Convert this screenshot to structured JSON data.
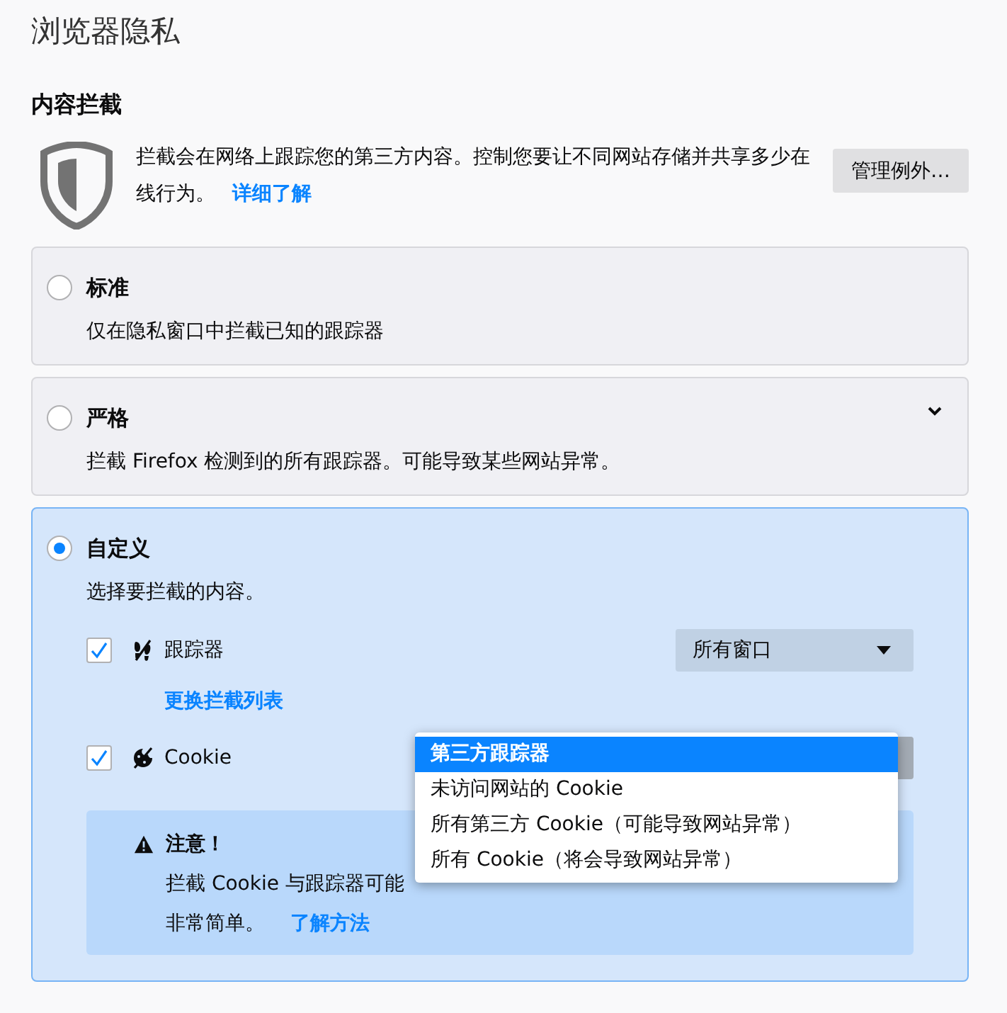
{
  "page": {
    "title": "浏览器隐私"
  },
  "content_blocking": {
    "heading": "内容拦截",
    "description": "拦截会在网络上跟踪您的第三方内容。控制您要让不同网站存储并共享多少在线行为。",
    "learn_more_link": "详细了解",
    "exceptions_button": "管理例外…"
  },
  "modes": [
    {
      "title": "标准",
      "description": "仅在隐私窗口中拦截已知的跟踪器",
      "selected": false,
      "expandable": false
    },
    {
      "title": "严格",
      "description": "拦截 Firefox 检测到的所有跟踪器。可能导致某些网站异常。",
      "selected": false,
      "expandable": true
    },
    {
      "title": "自定义",
      "description": "选择要拦截的内容。",
      "selected": true,
      "expandable": false,
      "options": [
        {
          "kind": "tracker",
          "label": "跟踪器",
          "checked": true,
          "dropdown": {
            "value": "所有窗口",
            "open": false
          },
          "link": "更换拦截列表"
        },
        {
          "kind": "cookie",
          "label": "Cookie",
          "checked": true,
          "dropdown": {
            "open": true,
            "menu": [
              {
                "label": "第三方跟踪器",
                "selected": true
              },
              {
                "label": "未访问网站的 Cookie",
                "selected": false
              },
              {
                "label": "所有第三方 Cookie（可能导致网站异常）",
                "selected": false
              },
              {
                "label": "所有 Cookie（将会导致网站异常）",
                "selected": false
              }
            ]
          }
        }
      ],
      "warning": {
        "title": "注意！",
        "text": "拦截 Cookie 与跟踪器可能",
        "text_continued": "非常简单。",
        "link": "了解方法"
      }
    }
  ]
}
